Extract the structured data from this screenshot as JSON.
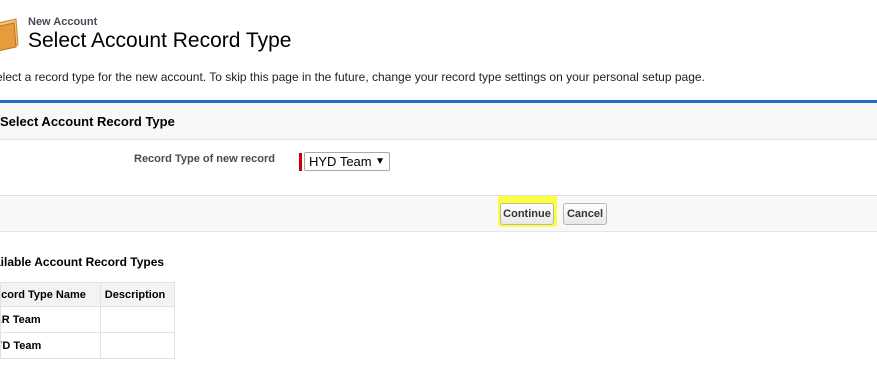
{
  "header": {
    "subtitle": "New Account",
    "title": "Select Account Record Type",
    "instructions": "elect a record type for the new account. To skip this page in the future, change your record type settings on your personal setup page."
  },
  "panel": {
    "title": "Select Account Record Type",
    "field_label": "Record Type of new record",
    "selected_value": "HYD Team",
    "continue_label": "Continue",
    "cancel_label": "Cancel"
  },
  "available": {
    "title": "ailable Account Record Types",
    "columns": [
      "ecord Type Name",
      "Description"
    ],
    "rows": [
      {
        "name": "LR Team",
        "description": ""
      },
      {
        "name": "YD Team",
        "description": ""
      }
    ]
  },
  "colors": {
    "accent": "#1f6fbf",
    "required": "#cc0000",
    "highlight": "#fbff3e"
  },
  "icons": {
    "header": "folder-icon",
    "select": "dropdown-arrow-icon"
  }
}
